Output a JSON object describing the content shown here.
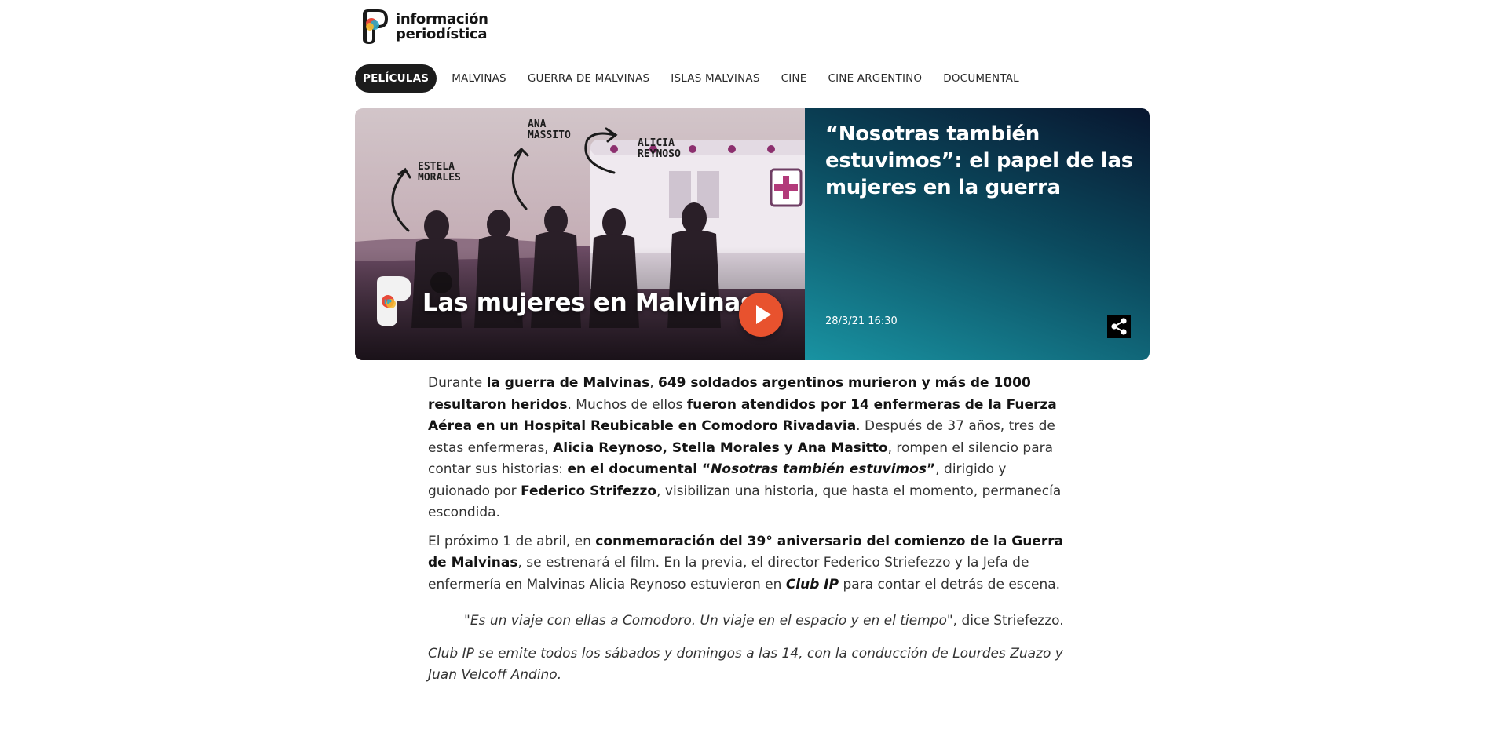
{
  "site": {
    "logo_line1": "información",
    "logo_line2": "periodística",
    "logo_badge": "IP"
  },
  "tags": [
    "PELÍCULAS",
    "MALVINAS",
    "GUERRA DE MALVINAS",
    "ISLAS MALVINAS",
    "CINE",
    "CINE ARGENTINO",
    "DOCUMENTAL"
  ],
  "hero": {
    "title": "“Nosotras también estuvimos”: el papel de las mujeres en la guerra",
    "date": "28/3/21 16:30",
    "video_caption": "Las mujeres en Malvinas",
    "names": {
      "n1": "ESTELA\nMORALES",
      "n2": "ANA\nMASSITO",
      "n3": "ALICIA\nREYNOSO"
    }
  },
  "article": {
    "p1": {
      "a": "Durante ",
      "b": "la guerra de Malvinas",
      "c": ", ",
      "d": "649 soldados argentinos murieron y más de 1000 resultaron heridos",
      "e": ". Muchos de ellos ",
      "f": "fueron atendidos por 14 enfermeras de la Fuerza Aérea en un Hospital Reubicable en Comodoro Rivadavia",
      "g": ". Después de 37 años, tres de estas enfermeras, ",
      "h": "Alicia Reynoso, Stella Morales y Ana Masitto",
      "i": ", rompen el silencio para contar sus historias: ",
      "j": "en el documental “",
      "k": "Nosotras también estuvimos",
      "l": "”",
      "m": ", dirigido y guionado por ",
      "n": "Federico Strifezzo",
      "o": ", visibilizan una historia, que hasta el momento, permanecía escondida."
    },
    "p2": {
      "a": "El próximo 1 de abril, en ",
      "b": "conmemoración del 39° aniversario del comienzo de la Guerra de Malvinas",
      "c": ", se estrenará el film. En la previa, el director Federico Striefezzo y la Jefa de enfermería en Malvinas Alicia Reynoso estuvieron en ",
      "d": "Club IP",
      "e": " para contar el detrás de escena."
    },
    "quote": {
      "open": "\"",
      "text": "Es un viaje con ellas a Comodoro. Un viaje en el espacio y en el tiempo",
      "close": "\", dice Striefezzo."
    },
    "closing": "Club IP se emite todos los sábados y domingos a las 14, con la conducción de Lourdes Zuazo y Juan Velcoff Andino."
  }
}
